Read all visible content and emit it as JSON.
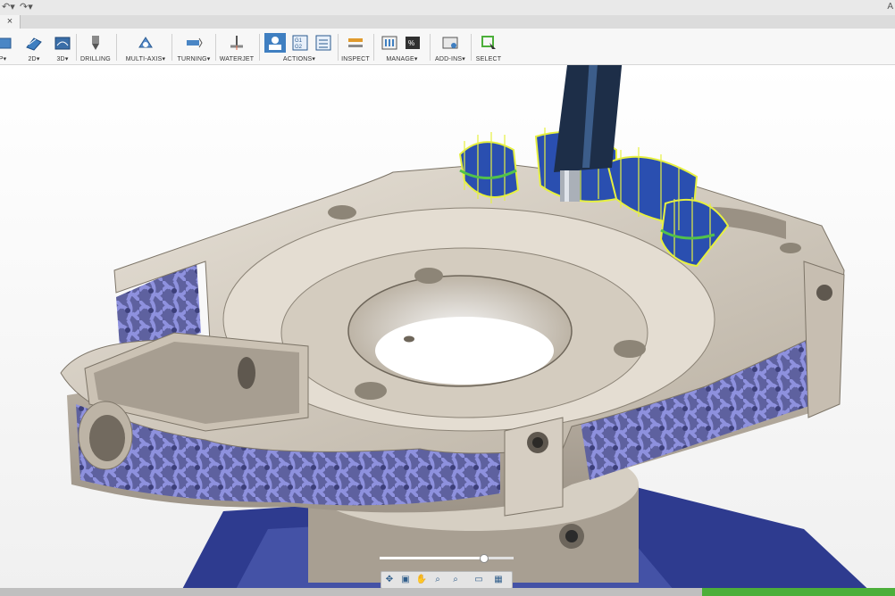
{
  "titlebar": {
    "undo_icon": "undo-icon",
    "redo_icon": "redo-icon",
    "right_text": "A"
  },
  "tab": {
    "close_label": "×"
  },
  "ribbon": {
    "groups": [
      {
        "id": "setup",
        "label": "P▾"
      },
      {
        "id": "2d",
        "label": "2D▾"
      },
      {
        "id": "3d",
        "label": "3D▾"
      },
      {
        "id": "drilling",
        "label": "DRILLING"
      },
      {
        "id": "multiaxis",
        "label": "MULTI-AXIS▾"
      },
      {
        "id": "turning",
        "label": "TURNING▾"
      },
      {
        "id": "waterjet",
        "label": "WATERJET"
      },
      {
        "id": "actions",
        "label": "ACTIONS▾"
      },
      {
        "id": "inspect",
        "label": "INSPECT"
      },
      {
        "id": "manage",
        "label": "MANAGE▾"
      },
      {
        "id": "addins",
        "label": "ADD-INS▾"
      },
      {
        "id": "select",
        "label": "SELECT"
      }
    ]
  },
  "playback": {
    "buttons": [
      {
        "name": "go-to-start",
        "glyph": "|◀"
      },
      {
        "name": "previous-operation",
        "glyph": "●◀"
      },
      {
        "name": "step-back",
        "glyph": "«"
      },
      {
        "name": "play-pause",
        "glyph": "||"
      },
      {
        "name": "step-forward",
        "glyph": "»"
      },
      {
        "name": "next-operation",
        "glyph": "▶●"
      },
      {
        "name": "go-to-end",
        "glyph": "▶|"
      }
    ],
    "progress": 0.77
  },
  "viewtools": {
    "buttons": [
      {
        "name": "orbit-tool",
        "glyph": "✥"
      },
      {
        "name": "look-at-tool",
        "glyph": "▣"
      },
      {
        "name": "pan-tool",
        "glyph": "✋"
      },
      {
        "name": "zoom-tool",
        "glyph": "⌕"
      },
      {
        "name": "fit-tool",
        "glyph": "⌕"
      },
      {
        "name": "display-settings",
        "glyph": "▭"
      },
      {
        "name": "grid-settings",
        "glyph": "▦"
      }
    ]
  },
  "colors": {
    "part": "#d8d0c4",
    "lattice": "#7c7fc9",
    "toolpath": "#e6f040",
    "toolpath_blue": "#2a4fb0",
    "tool": "#1d2e48",
    "fixture": "#2e3b8f"
  }
}
